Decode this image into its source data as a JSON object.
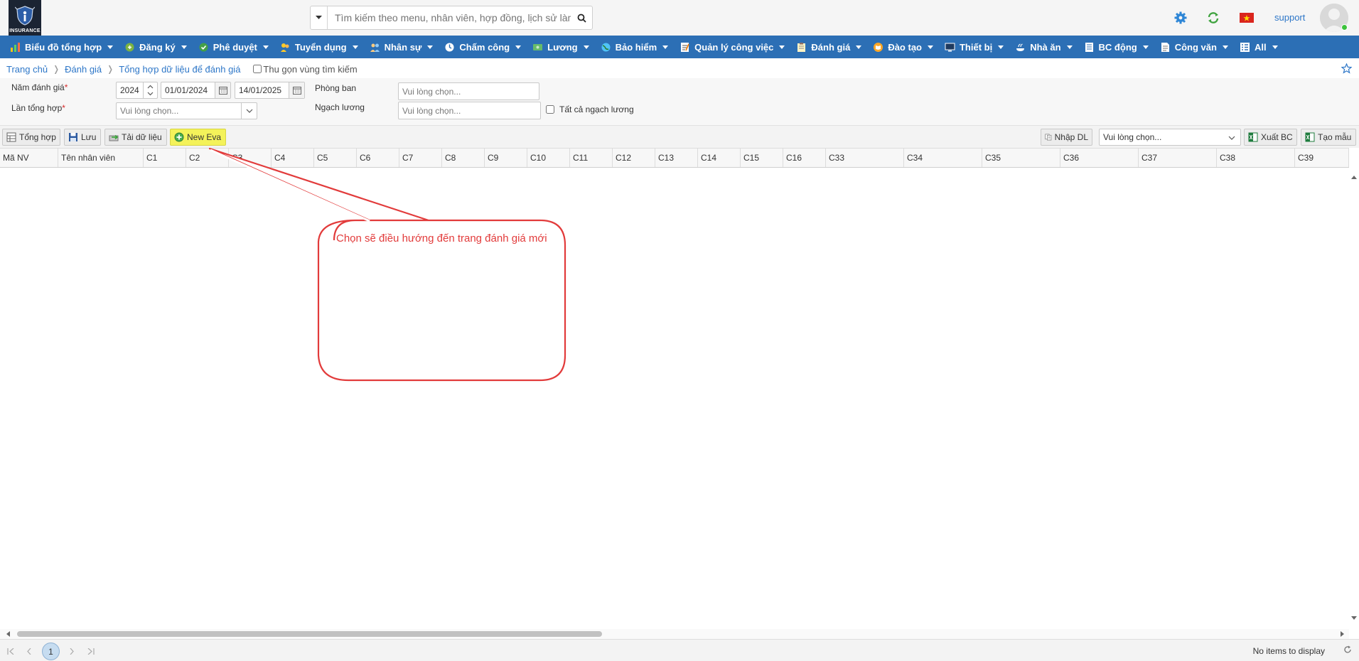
{
  "header": {
    "logo_text": "INSURANCE",
    "search_placeholder": "Tìm kiếm theo menu, nhân viên, hợp đồng, lịch sử làm",
    "user_label": "support"
  },
  "menu": [
    {
      "label": "Biểu đồ tổng hợp",
      "icon": "chart-icon"
    },
    {
      "label": "Đăng ký",
      "icon": "register-icon"
    },
    {
      "label": "Phê duyệt",
      "icon": "check-icon"
    },
    {
      "label": "Tuyển dụng",
      "icon": "recruit-icon"
    },
    {
      "label": "Nhân sự",
      "icon": "people-icon"
    },
    {
      "label": "Chấm công",
      "icon": "clock-icon"
    },
    {
      "label": "Lương",
      "icon": "money-icon"
    },
    {
      "label": "Bảo hiểm",
      "icon": "globe-icon"
    },
    {
      "label": "Quản lý công việc",
      "icon": "task-icon"
    },
    {
      "label": "Đánh giá",
      "icon": "clipboard-icon"
    },
    {
      "label": "Đào tạo",
      "icon": "book-icon"
    },
    {
      "label": "Thiết bị",
      "icon": "monitor-icon"
    },
    {
      "label": "Nhà ăn",
      "icon": "food-icon"
    },
    {
      "label": "BC động",
      "icon": "report-icon"
    },
    {
      "label": "Công văn",
      "icon": "document-icon"
    },
    {
      "label": "All",
      "icon": "list-icon"
    }
  ],
  "breadcrumb": {
    "home": "Trang chủ",
    "section": "Đánh giá",
    "current": "Tổng hợp dữ liệu để đánh giá",
    "collapse_label": "Thu gọn vùng tìm kiếm"
  },
  "filters": {
    "year_label": "Năm đánh giá",
    "year_value": "2024",
    "date_from": "01/01/2024",
    "date_to": "14/01/2025",
    "round_label": "Lần tổng hợp",
    "round_placeholder": "Vui lòng chọn...",
    "department_label": "Phòng ban",
    "department_placeholder": "Vui lòng chọn...",
    "salary_grade_label": "Ngạch lương",
    "salary_grade_placeholder": "Vui lòng chọn...",
    "all_grades_label": "Tất cả ngạch lương",
    "required_mark": "*"
  },
  "toolbar": {
    "summarize": "Tổng hợp",
    "save": "Lưu",
    "load": "Tải dữ liệu",
    "new_eva": "New Eva",
    "import": "Nhập DL",
    "template_placeholder": "Vui lòng chọn...",
    "export": "Xuất BC",
    "create_template": "Tạo mẫu"
  },
  "grid": {
    "columns": [
      "Mã NV",
      "Tên nhân viên",
      "C1",
      "C2",
      "C3",
      "C4",
      "C5",
      "C6",
      "C7",
      "C8",
      "C9",
      "C10",
      "C11",
      "C12",
      "C13",
      "C14",
      "C15",
      "C16",
      "C33",
      "C34",
      "C35",
      "C36",
      "C37",
      "C38",
      "C39"
    ]
  },
  "pager": {
    "page": "1",
    "info": "No items to display"
  },
  "annotation": {
    "text": "Chọn sẽ điều hướng đến trang đánh giá mới",
    "color": "#e23b3b"
  },
  "colors": {
    "menubar": "#2c6fb5",
    "highlight": "#f4f25a",
    "link": "#2e77c8"
  }
}
